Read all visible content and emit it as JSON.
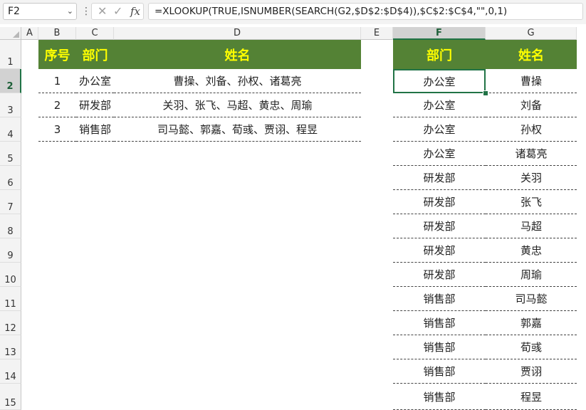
{
  "formula_bar": {
    "name_box": "F2",
    "formula": "=XLOOKUP(TRUE,ISNUMBER(SEARCH(G2,$D$2:$D$4)),$C$2:$C$4,\"\",0,1)",
    "fx_label": "fx"
  },
  "columns": [
    "A",
    "B",
    "C",
    "D",
    "E",
    "F",
    "G"
  ],
  "rows": [
    "1",
    "2",
    "3",
    "4",
    "5",
    "6",
    "7",
    "8",
    "9",
    "10",
    "11",
    "12",
    "13",
    "14",
    "15"
  ],
  "left_table": {
    "headers": [
      "序号",
      "部门",
      "姓名"
    ],
    "rows": [
      [
        "1",
        "办公室",
        "曹操、刘备、孙权、诸葛亮"
      ],
      [
        "2",
        "研发部",
        "关羽、张飞、马超、黄忠、周瑜"
      ],
      [
        "3",
        "销售部",
        "司马懿、郭嘉、荀彧、贾诩、程昱"
      ]
    ]
  },
  "right_table": {
    "headers": [
      "部门",
      "姓名"
    ],
    "rows": [
      [
        "办公室",
        "曹操"
      ],
      [
        "办公室",
        "刘备"
      ],
      [
        "办公室",
        "孙权"
      ],
      [
        "办公室",
        "诸葛亮"
      ],
      [
        "研发部",
        "关羽"
      ],
      [
        "研发部",
        "张飞"
      ],
      [
        "研发部",
        "马超"
      ],
      [
        "研发部",
        "黄忠"
      ],
      [
        "研发部",
        "周瑜"
      ],
      [
        "销售部",
        "司马懿"
      ],
      [
        "销售部",
        "郭嘉"
      ],
      [
        "销售部",
        "荀彧"
      ],
      [
        "销售部",
        "贾诩"
      ],
      [
        "销售部",
        "程昱"
      ]
    ]
  },
  "colors": {
    "header_fill": "#548235",
    "header_text": "#ffff00",
    "selection": "#217346"
  }
}
